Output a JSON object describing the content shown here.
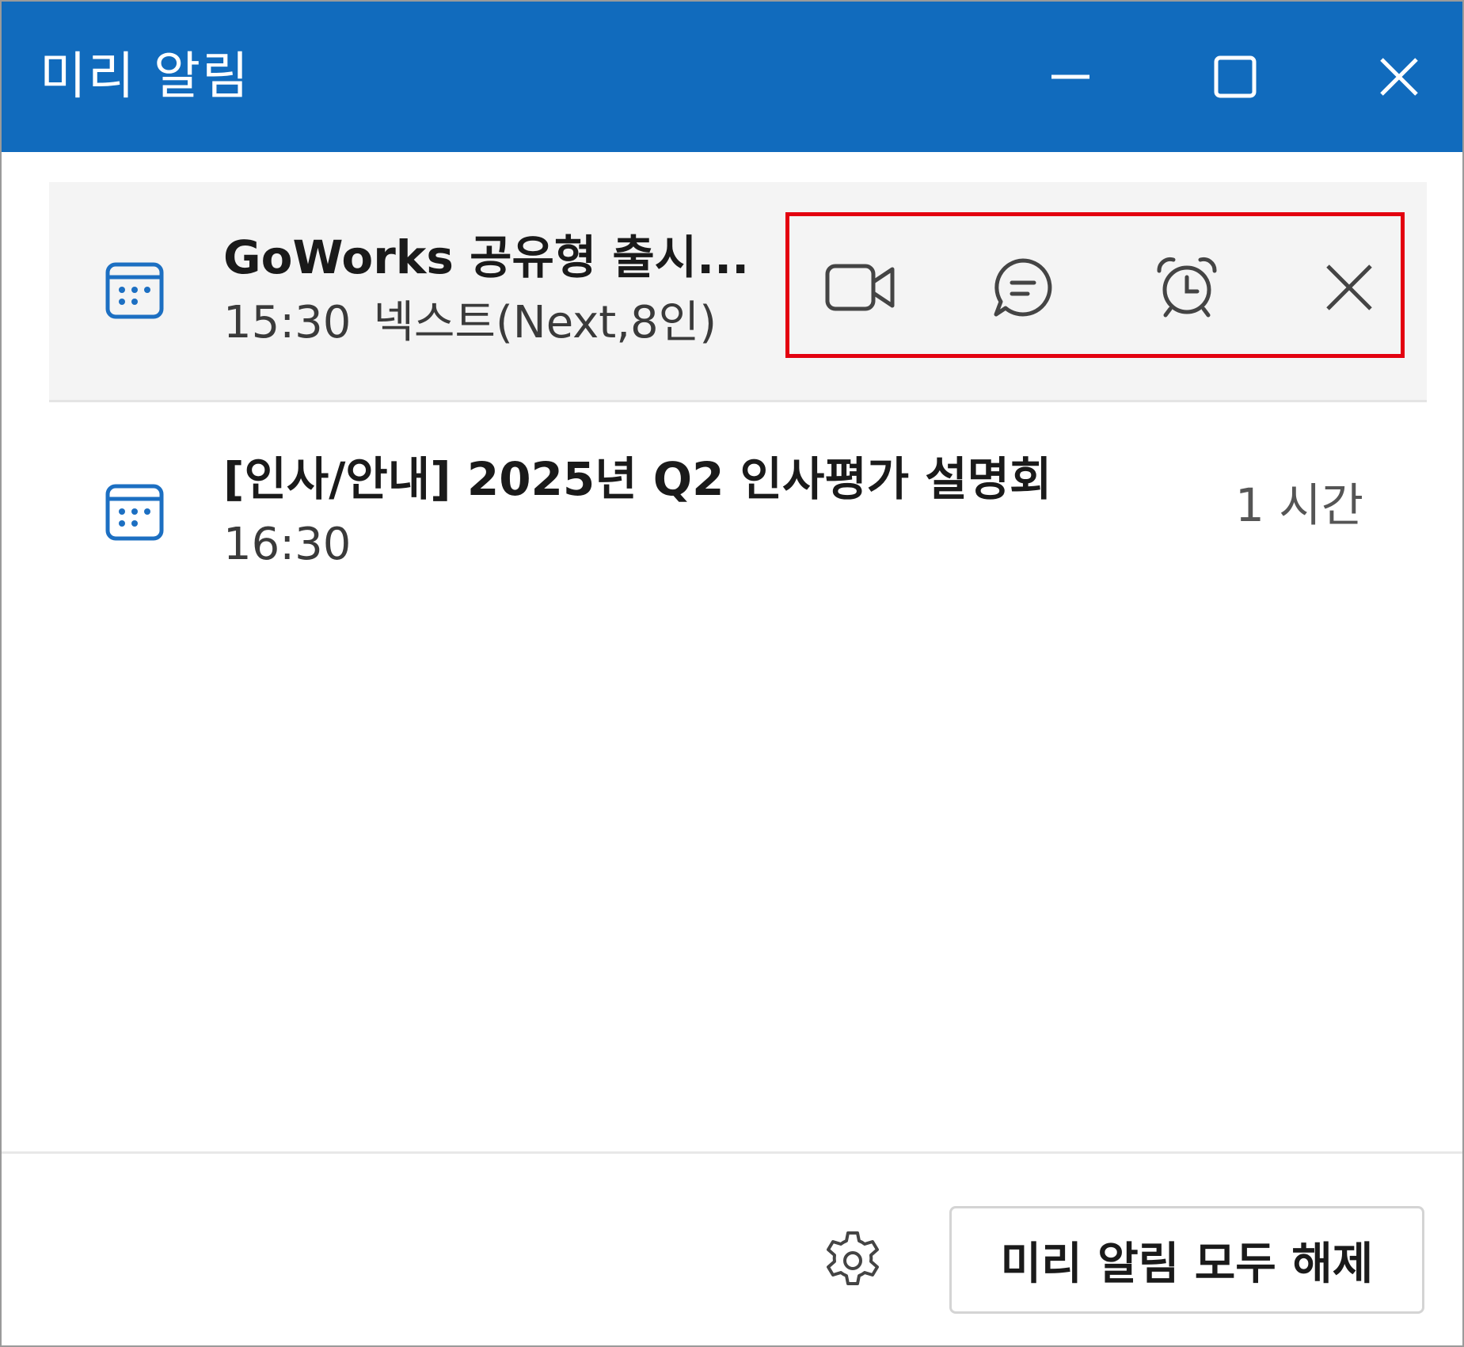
{
  "window": {
    "title": "미리 알림",
    "accent_color": "#116bbd",
    "controls": [
      "minimize-icon",
      "maximize-icon",
      "close-icon"
    ]
  },
  "reminders": [
    {
      "icon": "calendar-icon",
      "title": "GoWorks 공유형 출시...",
      "time": "15:30",
      "location": "넥스트(Next,8인)",
      "selected": true,
      "actions": [
        {
          "icon": "video-call-icon"
        },
        {
          "icon": "chat-icon"
        },
        {
          "icon": "snooze-alarm-icon"
        },
        {
          "icon": "dismiss-icon"
        }
      ]
    },
    {
      "icon": "calendar-icon",
      "title": "[인사/안내] 2025년 Q2 인사평가 설명회",
      "time": "16:30",
      "due": "1 시간",
      "selected": false
    }
  ],
  "footer": {
    "settings_icon": "gear-icon",
    "dismiss_all_label": "미리 알림 모두 해제"
  },
  "highlight_color": "#e3000f"
}
